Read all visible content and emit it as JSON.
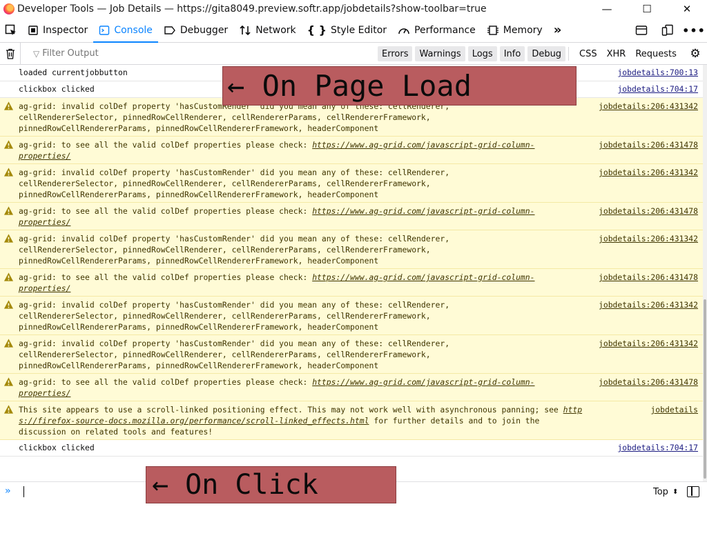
{
  "window": {
    "title": "Developer Tools — Job Details — https://gita8049.preview.softr.app/jobdetails?show-toolbar=true",
    "minimize": "—",
    "maximize": "☐",
    "close": "✕"
  },
  "tabs": [
    {
      "label": "Inspector",
      "icon": "inspector-icon"
    },
    {
      "label": "Console",
      "icon": "console-icon",
      "active": true
    },
    {
      "label": "Debugger",
      "icon": "debugger-icon"
    },
    {
      "label": "Network",
      "icon": "network-icon"
    },
    {
      "label": "Style Editor",
      "icon": "style-editor-icon"
    },
    {
      "label": "Performance",
      "icon": "performance-icon"
    },
    {
      "label": "Memory",
      "icon": "memory-icon"
    }
  ],
  "filter": {
    "placeholder": "Filter Output",
    "levels": [
      "Errors",
      "Warnings",
      "Logs",
      "Info",
      "Debug"
    ],
    "net": [
      "CSS",
      "XHR",
      "Requests"
    ]
  },
  "messages": [
    {
      "type": "log",
      "lines": [
        "loaded currentjobbutton"
      ],
      "source": "jobdetails:700:13"
    },
    {
      "type": "log",
      "lines": [
        "clickbox clicked"
      ],
      "source": "jobdetails:704:17"
    },
    {
      "type": "warn",
      "lines": [
        "ag-grid: invalid colDef property 'hasCustomRender' did you mean any of these: cellRenderer,",
        "cellRendererSelector, pinnedRowCellRenderer, cellRendererParams, cellRendererFramework,",
        "pinnedRowCellRendererParams, pinnedRowCellRendererFramework, headerComponent"
      ],
      "source": "jobdetails:206:431342"
    },
    {
      "type": "warn",
      "lines": [
        "ag-grid: to see all the valid colDef properties please check: "
      ],
      "link": [
        "https://www.ag-grid.com/javascript-grid-column-",
        "properties/"
      ],
      "source": "jobdetails:206:431478"
    },
    {
      "type": "warn",
      "lines": [
        "ag-grid: invalid colDef property 'hasCustomRender' did you mean any of these: cellRenderer,",
        "cellRendererSelector, pinnedRowCellRenderer, cellRendererParams, cellRendererFramework,",
        "pinnedRowCellRendererParams, pinnedRowCellRendererFramework, headerComponent"
      ],
      "source": "jobdetails:206:431342"
    },
    {
      "type": "warn",
      "lines": [
        "ag-grid: to see all the valid colDef properties please check: "
      ],
      "link": [
        "https://www.ag-grid.com/javascript-grid-column-",
        "properties/"
      ],
      "source": "jobdetails:206:431478"
    },
    {
      "type": "warn",
      "lines": [
        "ag-grid: invalid colDef property 'hasCustomRender' did you mean any of these: cellRenderer,",
        "cellRendererSelector, pinnedRowCellRenderer, cellRendererParams, cellRendererFramework,",
        "pinnedRowCellRendererParams, pinnedRowCellRendererFramework, headerComponent"
      ],
      "source": "jobdetails:206:431342"
    },
    {
      "type": "warn",
      "lines": [
        "ag-grid: to see all the valid colDef properties please check: "
      ],
      "link": [
        "https://www.ag-grid.com/javascript-grid-column-",
        "properties/"
      ],
      "source": "jobdetails:206:431478"
    },
    {
      "type": "warn",
      "lines": [
        "ag-grid: invalid colDef property 'hasCustomRender' did you mean any of these: cellRenderer,",
        "cellRendererSelector, pinnedRowCellRenderer, cellRendererParams, cellRendererFramework,",
        "pinnedRowCellRendererParams, pinnedRowCellRendererFramework, headerComponent"
      ],
      "source": "jobdetails:206:431342"
    },
    {
      "type": "warn",
      "lines": [
        "ag-grid: invalid colDef property 'hasCustomRender' did you mean any of these: cellRenderer,",
        "cellRendererSelector, pinnedRowCellRenderer, cellRendererParams, cellRendererFramework,",
        "pinnedRowCellRendererParams, pinnedRowCellRendererFramework, headerComponent"
      ],
      "source": "jobdetails:206:431342"
    },
    {
      "type": "warn",
      "lines": [
        "ag-grid: to see all the valid colDef properties please check: "
      ],
      "link": [
        "https://www.ag-grid.com/javascript-grid-column-",
        "properties/"
      ],
      "source": "jobdetails:206:431478"
    },
    {
      "type": "warn",
      "lines": [
        "This site appears to use a scroll-linked positioning effect. This may not work well with asynchronous panning; see "
      ],
      "link": [
        "http",
        "s://firefox-source-docs.mozilla.org/performance/scroll-linked_effects.html"
      ],
      "tail": [
        " for further details and to join the",
        "discussion on related tools and features!"
      ],
      "source": "jobdetails"
    },
    {
      "type": "log",
      "lines": [
        "clickbox clicked"
      ],
      "source": "jobdetails:704:17"
    }
  ],
  "input": {
    "prompt": "»",
    "context": "Top"
  },
  "annotations": {
    "on_page_load": "← On Page Load",
    "on_click": "← On Click"
  }
}
